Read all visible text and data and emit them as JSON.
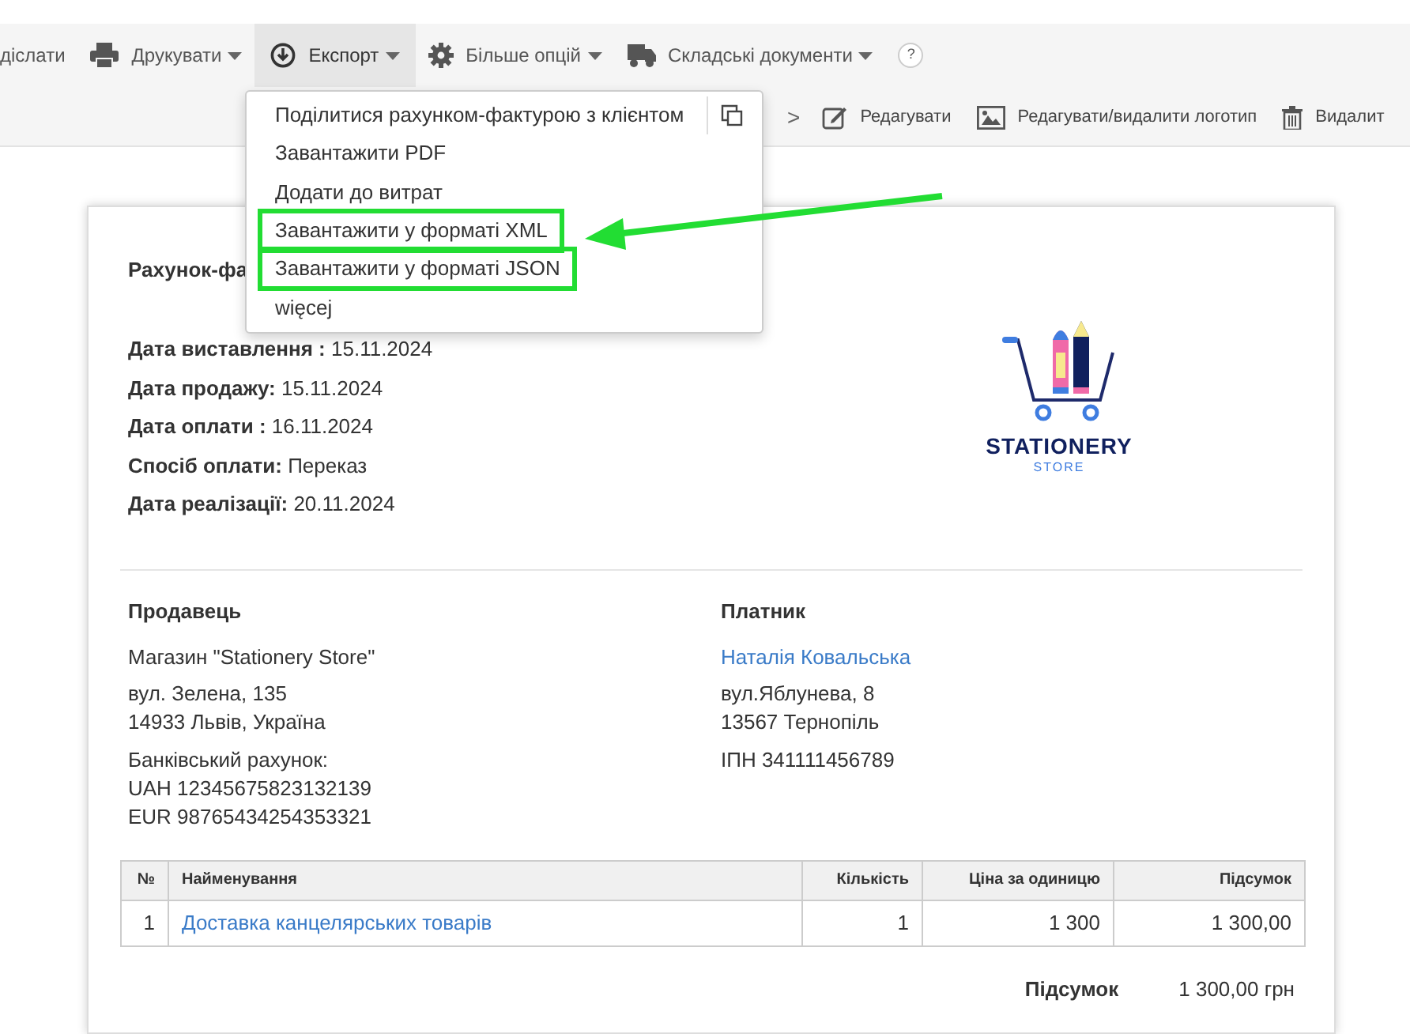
{
  "toolbar": [
    {
      "kind": "text",
      "label": "діслати",
      "selected": false
    },
    {
      "kind": "print",
      "label": "Друкувати",
      "selected": false
    },
    {
      "kind": "export",
      "label": "Експорт",
      "selected": true
    },
    {
      "kind": "gear",
      "label": "Більше опцій",
      "selected": false
    },
    {
      "kind": "truck",
      "label": "Складські документи",
      "selected": false
    }
  ],
  "help": "?",
  "actions": [
    {
      "kind": "chevron",
      "label": ">"
    },
    {
      "kind": "edit",
      "label": "Редагувати"
    },
    {
      "kind": "image",
      "label": "Редагувати/видалити логотип"
    },
    {
      "kind": "trash",
      "label": "Видалит"
    }
  ],
  "export_menu": [
    {
      "label": "Поділитися рахунком-фактурою з клієнтом",
      "copy": true,
      "highlighted": false
    },
    {
      "label": "Завантажити PDF",
      "copy": false,
      "highlighted": false
    },
    {
      "label": "Додати до витрат",
      "copy": false,
      "highlighted": false
    },
    {
      "label": "Завантажити у форматі XML",
      "copy": false,
      "highlighted": true
    },
    {
      "label": "Завантажити у форматі JSON",
      "copy": false,
      "highlighted": true
    },
    {
      "label": "więcej",
      "copy": false,
      "highlighted": false
    }
  ],
  "invoice": {
    "title": "Рахунок-фа",
    "details": [
      {
        "label": "Дата виставлення :",
        "value": "15.11.2024"
      },
      {
        "label": "Дата продажу:",
        "value": "15.11.2024"
      },
      {
        "label": "Дата оплати :",
        "value": "16.11.2024"
      },
      {
        "label": "Спосіб оплати:",
        "value": "Переказ"
      },
      {
        "label": "Дата реалізації:",
        "value": "20.11.2024"
      }
    ],
    "logo": {
      "name": "STATIONERY",
      "sub": "STORE"
    },
    "seller": {
      "heading": "Продавець",
      "name": "Магазин \"Stationery Store\"",
      "address": [
        "вул. Зелена, 135",
        "14933 Львів, Україна"
      ],
      "bank": [
        "Банківський рахунок:",
        "UAH 12345675823132139",
        "EUR 98765434254353321"
      ]
    },
    "payer": {
      "heading": "Платник",
      "name": "Наталія Ковальська",
      "address": [
        "вул.Яблунева, 8",
        "13567 Тернопіль"
      ],
      "tax": "ІПН 341111456789"
    },
    "table": {
      "columns": [
        "№",
        "Найменування",
        "Кількість",
        "Ціна за одиницю",
        "Підсумок"
      ],
      "rows": [
        [
          "1",
          "Доставка канцелярських товарів",
          "1",
          "1 300",
          "1 300,00"
        ]
      ]
    },
    "total": {
      "label": "Підсумок",
      "value": "1 300,00 грн"
    }
  }
}
